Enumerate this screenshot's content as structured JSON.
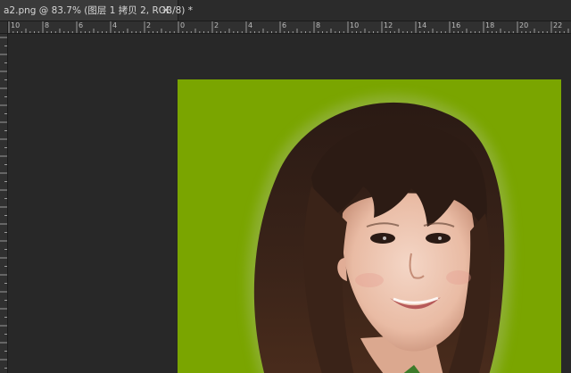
{
  "document": {
    "tab_title": "a2.png @ 83.7% (图层 1 拷贝 2, RGB/8) *",
    "close_glyph": "×"
  },
  "ruler": {
    "top_labels": [
      "10",
      "8",
      "6",
      "4",
      "2",
      "0",
      "2",
      "4",
      "6",
      "8",
      "10",
      "12",
      "14",
      "16",
      "18",
      "20",
      "22"
    ]
  },
  "colors": {
    "workspace": "#282828",
    "image_background": "#7aa500",
    "ruler": "#303030",
    "tab_active": "#3a3a3a"
  },
  "canvas": {
    "image_description_icon": "portrait-image"
  }
}
